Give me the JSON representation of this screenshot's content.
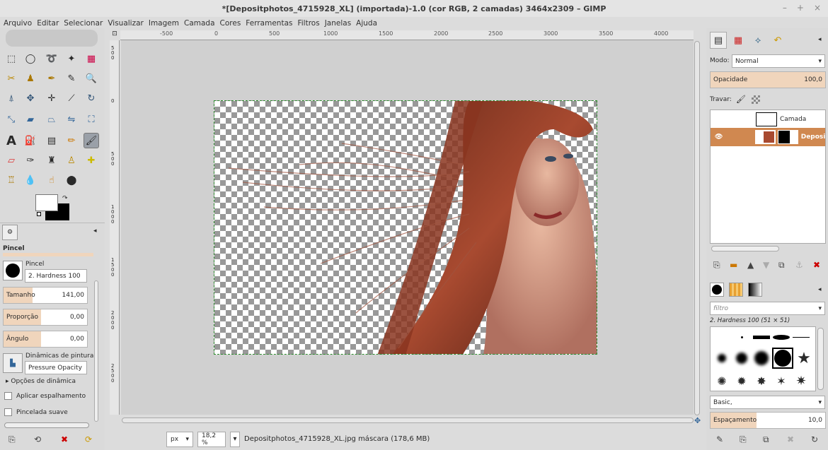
{
  "window": {
    "title": "*[Depositphotos_4715928_XL] (importada)-1.0 (cor RGB, 2 camadas) 3464x2309 – GIMP",
    "controls": [
      "–",
      "+",
      "×"
    ]
  },
  "menu": [
    "Arquivo",
    "Editar",
    "Selecionar",
    "Visualizar",
    "Imagem",
    "Camada",
    "Cores",
    "Ferramentas",
    "Filtros",
    "Janelas",
    "Ajuda"
  ],
  "ruler": {
    "h_labels": [
      "-500",
      "0",
      "500",
      "1000",
      "1500",
      "2000",
      "2500",
      "3000",
      "3500",
      "4000"
    ],
    "v_labels": [
      "500",
      "0",
      "500",
      "1000",
      "1500",
      "2000",
      "2500"
    ]
  },
  "tool_options": {
    "title": "Pincel",
    "brush_label": "Pincel",
    "brush_value": "2. Hardness 100",
    "size_label": "Tamanho",
    "size_value": "141,00",
    "size_fraction": 0.35,
    "ratio_label": "Proporção",
    "ratio_value": "0,00",
    "ratio_fraction": 0.45,
    "angle_label": "Ângulo",
    "angle_value": "0,00",
    "angle_fraction": 0.45,
    "dynamics_label": "Dinâmicas de pintura",
    "dynamics_value": "Pressure Opacity",
    "dynamics_options_label": "Opções de dinâmica",
    "scatter_label": "Aplicar espalhamento",
    "smooth_label": "Pincelada suave"
  },
  "statusbar": {
    "unit": "px",
    "zoom": "18,2 %",
    "info": "Depositphotos_4715928_XL.jpg máscara (178,6 MB)"
  },
  "layers": {
    "mode_label": "Modo:",
    "mode_value": "Normal",
    "opacity_label": "Opacidade",
    "opacity_value": "100,0",
    "lock_label": "Travar:",
    "items": [
      {
        "name": "Camada",
        "selected": false
      },
      {
        "name": "Deposit",
        "selected": true
      }
    ]
  },
  "brushes": {
    "filter_placeholder": "filtro",
    "current": "2. Hardness 100 (51 × 51)",
    "tag_value": "Basic,",
    "spacing_label": "Espaçamento",
    "spacing_value": "10,0"
  },
  "colors": {
    "accent": "#e0a070",
    "selection_layer": "#d08850"
  }
}
